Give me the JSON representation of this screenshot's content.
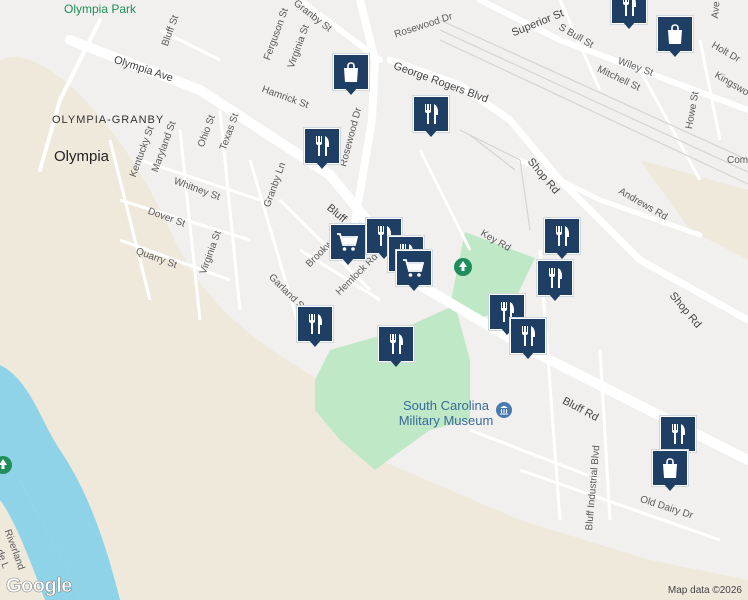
{
  "map": {
    "attribution": "Map data ©2026",
    "logo": "Google",
    "colors": {
      "land": "#f1f0ee",
      "river": "#8fd3e8",
      "park": "#bfe8c6",
      "sand": "#efe9dc",
      "road": "#ffffff",
      "pin": "#1e3f63"
    },
    "areas": {
      "neighborhood": "OLYMPIA-GRANBY",
      "city": "Olympia",
      "park": "Olympia Park"
    },
    "poi": {
      "line1": "South Carolina",
      "line2": "Military Museum",
      "icon": "museum-icon"
    },
    "streets": {
      "bluff_st": "Bluff St",
      "granby_st": "Granby St",
      "rosewood_dr_top": "Rosewood Dr",
      "rosewood_dr": "Rosewood Dr",
      "superior_st": "Superior St",
      "s_bull_st": "S Bull St",
      "holt_dr": "Holt Dr",
      "ave": "Ave",
      "wiley_st": "Wiley St",
      "mitchell_st": "Mitchell St",
      "kingswood": "Kingswo",
      "howe_st": "Howe St",
      "com": "Com",
      "ferguson_st": "Ferguson St",
      "virginia_st_top": "Virginia St",
      "olympia_ave": "Olympia Ave",
      "hamrick_st": "Hamrick St",
      "george_rogers_blvd": "George Rogers Blvd",
      "ohio_st": "Ohio St",
      "texas_st": "Texas St",
      "kentucky_st": "Kentucky St",
      "maryland_st": "Maryland St",
      "whitney_st": "Whitney St",
      "granby_ln": "Granby Ln",
      "dover_st": "Dover St",
      "quarry_st": "Quarry St",
      "virginia_st": "Virginia St",
      "bluff": "Bluff",
      "brookwood": "Brookwo",
      "hemlock_rd": "Hemlock Rd",
      "garland_st": "Garland St",
      "shop_rd": "Shop Rd",
      "shop_rd_2": "Shop Rd",
      "andrews_rd": "Andrews Rd",
      "key_rd": "Key Rd",
      "bluff_rd": "Bluff Rd",
      "bluff_industrial_blvd": "Bluff Industrial Blvd",
      "old_dairy_dr": "Old Dairy Dr",
      "riverland": "Riverland",
      "de_l": "de L"
    },
    "pins": [
      {
        "type": "restaurant-icon"
      },
      {
        "type": "shopping-bag-icon"
      },
      {
        "type": "shopping-bag-icon"
      },
      {
        "type": "restaurant-icon"
      },
      {
        "type": "restaurant-icon"
      },
      {
        "type": "shopping-cart-icon"
      },
      {
        "type": "restaurant-icon"
      },
      {
        "type": "restaurant-icon"
      },
      {
        "type": "shopping-cart-icon"
      },
      {
        "type": "restaurant-icon"
      },
      {
        "type": "restaurant-icon"
      },
      {
        "type": "restaurant-icon"
      },
      {
        "type": "restaurant-icon"
      },
      {
        "type": "restaurant-icon"
      },
      {
        "type": "restaurant-icon"
      },
      {
        "type": "restaurant-icon"
      },
      {
        "type": "shopping-bag-icon"
      }
    ]
  }
}
